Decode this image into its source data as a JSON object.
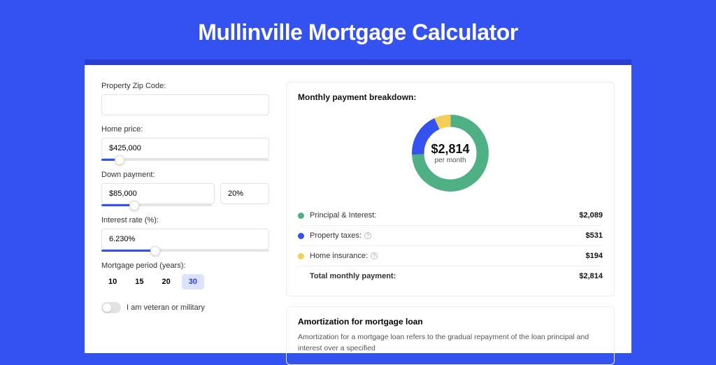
{
  "page": {
    "title": "Mullinville Mortgage Calculator"
  },
  "form": {
    "zip": {
      "label": "Property Zip Code:",
      "value": ""
    },
    "home_price": {
      "label": "Home price:",
      "value": "$425,000",
      "slider_pct": 11
    },
    "down_payment": {
      "label": "Down payment:",
      "amount": "$85,000",
      "pct": "20%",
      "slider_pct": 20
    },
    "interest": {
      "label": "Interest rate (%):",
      "value": "6.230%",
      "slider_pct": 32
    },
    "period": {
      "label": "Mortgage period (years):",
      "options": [
        "10",
        "15",
        "20",
        "30"
      ],
      "selected": "30"
    },
    "veteran": {
      "label": "I am veteran or military",
      "checked": false
    }
  },
  "breakdown": {
    "title": "Monthly payment breakdown:",
    "total_amount": "$2,814",
    "per_month": "per month",
    "items": [
      {
        "label": "Principal & Interest:",
        "value": "$2,089",
        "color": "#4fb086",
        "info": false
      },
      {
        "label": "Property taxes:",
        "value": "$531",
        "color": "#3452ef",
        "info": true
      },
      {
        "label": "Home insurance:",
        "value": "$194",
        "color": "#f3cf57",
        "info": true
      }
    ],
    "total_row": {
      "label": "Total monthly payment:",
      "value": "$2,814"
    }
  },
  "amortization": {
    "title": "Amortization for mortgage loan",
    "text": "Amortization for a mortgage loan refers to the gradual repayment of the loan principal and interest over a specified"
  },
  "chart_data": {
    "type": "pie",
    "title": "Monthly payment breakdown",
    "categories": [
      "Principal & Interest",
      "Property taxes",
      "Home insurance"
    ],
    "values": [
      2089,
      531,
      194
    ],
    "colors": [
      "#4fb086",
      "#3452ef",
      "#f3cf57"
    ],
    "total": 2814,
    "center_label": "$2,814 per month"
  }
}
